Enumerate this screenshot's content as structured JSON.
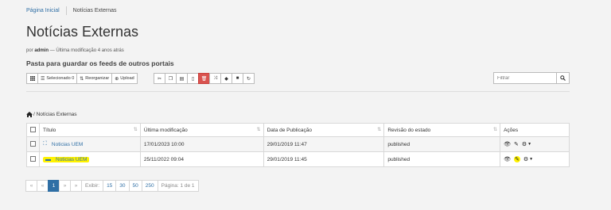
{
  "breadcrumbs": {
    "home": "Página Inicial",
    "current": "Notícias Externas"
  },
  "page": {
    "title": "Notícias Externas",
    "byline_prefix": "por",
    "byline_author": "admin",
    "byline_suffix": "— Última modificação 4 anos atrás",
    "description": "Pasta para guardar os feeds de outros portais"
  },
  "toolbar": {
    "selected_label": "Selecionado 0",
    "reorder_label": "Reorganizar",
    "upload_label": "Upload",
    "filter_placeholder": "Filtrar"
  },
  "path_label": "/ Notícias Externas",
  "table": {
    "headers": [
      "Título",
      "Última modificação",
      "Data de Publicação",
      "Revisão do estado",
      "Ações"
    ],
    "rows": [
      {
        "title": "Noticias UEM",
        "modified": "17/01/2023 10:00",
        "published": "29/01/2019 11:47",
        "state": "published",
        "icon": "feed-folder-icon"
      },
      {
        "title": "Noticias UEM",
        "modified": "25/11/2022 09:04",
        "published": "29/01/2019 11:45",
        "state": "published",
        "icon": "collection-icon"
      }
    ]
  },
  "pagination": {
    "first": "«",
    "prev_arrow": "«",
    "current": "1",
    "next_arrow": "»",
    "last": "»",
    "show_label": "Exibir:",
    "sizes": [
      "15",
      "30",
      "50",
      "250"
    ],
    "page_info": "Página: 1 de 1"
  },
  "colors": {
    "link": "#2f6fa5",
    "highlight": "#fff200",
    "danger": "#d9534f"
  }
}
